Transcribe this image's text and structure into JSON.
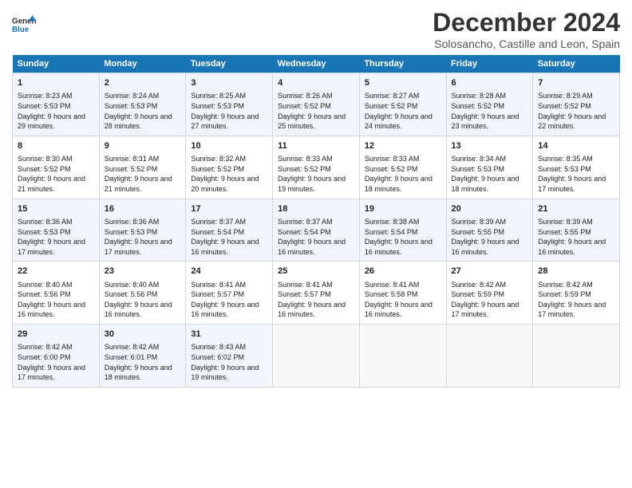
{
  "logo": {
    "line1": "General",
    "line2": "Blue"
  },
  "title": "December 2024",
  "subtitle": "Solosancho, Castille and Leon, Spain",
  "days_of_week": [
    "Sunday",
    "Monday",
    "Tuesday",
    "Wednesday",
    "Thursday",
    "Friday",
    "Saturday"
  ],
  "weeks": [
    [
      {
        "day": "1",
        "sunrise": "8:23 AM",
        "sunset": "5:53 PM",
        "daylight": "9 hours and 29 minutes."
      },
      {
        "day": "2",
        "sunrise": "8:24 AM",
        "sunset": "5:53 PM",
        "daylight": "9 hours and 28 minutes."
      },
      {
        "day": "3",
        "sunrise": "8:25 AM",
        "sunset": "5:53 PM",
        "daylight": "9 hours and 27 minutes."
      },
      {
        "day": "4",
        "sunrise": "8:26 AM",
        "sunset": "5:52 PM",
        "daylight": "9 hours and 25 minutes."
      },
      {
        "day": "5",
        "sunrise": "8:27 AM",
        "sunset": "5:52 PM",
        "daylight": "9 hours and 24 minutes."
      },
      {
        "day": "6",
        "sunrise": "8:28 AM",
        "sunset": "5:52 PM",
        "daylight": "9 hours and 23 minutes."
      },
      {
        "day": "7",
        "sunrise": "8:29 AM",
        "sunset": "5:52 PM",
        "daylight": "9 hours and 22 minutes."
      }
    ],
    [
      {
        "day": "8",
        "sunrise": "8:30 AM",
        "sunset": "5:52 PM",
        "daylight": "9 hours and 21 minutes."
      },
      {
        "day": "9",
        "sunrise": "8:31 AM",
        "sunset": "5:52 PM",
        "daylight": "9 hours and 21 minutes."
      },
      {
        "day": "10",
        "sunrise": "8:32 AM",
        "sunset": "5:52 PM",
        "daylight": "9 hours and 20 minutes."
      },
      {
        "day": "11",
        "sunrise": "8:33 AM",
        "sunset": "5:52 PM",
        "daylight": "9 hours and 19 minutes."
      },
      {
        "day": "12",
        "sunrise": "8:33 AM",
        "sunset": "5:52 PM",
        "daylight": "9 hours and 18 minutes."
      },
      {
        "day": "13",
        "sunrise": "8:34 AM",
        "sunset": "5:53 PM",
        "daylight": "9 hours and 18 minutes."
      },
      {
        "day": "14",
        "sunrise": "8:35 AM",
        "sunset": "5:53 PM",
        "daylight": "9 hours and 17 minutes."
      }
    ],
    [
      {
        "day": "15",
        "sunrise": "8:36 AM",
        "sunset": "5:53 PM",
        "daylight": "9 hours and 17 minutes."
      },
      {
        "day": "16",
        "sunrise": "8:36 AM",
        "sunset": "5:53 PM",
        "daylight": "9 hours and 17 minutes."
      },
      {
        "day": "17",
        "sunrise": "8:37 AM",
        "sunset": "5:54 PM",
        "daylight": "9 hours and 16 minutes."
      },
      {
        "day": "18",
        "sunrise": "8:37 AM",
        "sunset": "5:54 PM",
        "daylight": "9 hours and 16 minutes."
      },
      {
        "day": "19",
        "sunrise": "8:38 AM",
        "sunset": "5:54 PM",
        "daylight": "9 hours and 16 minutes."
      },
      {
        "day": "20",
        "sunrise": "8:39 AM",
        "sunset": "5:55 PM",
        "daylight": "9 hours and 16 minutes."
      },
      {
        "day": "21",
        "sunrise": "8:39 AM",
        "sunset": "5:55 PM",
        "daylight": "9 hours and 16 minutes."
      }
    ],
    [
      {
        "day": "22",
        "sunrise": "8:40 AM",
        "sunset": "5:56 PM",
        "daylight": "9 hours and 16 minutes."
      },
      {
        "day": "23",
        "sunrise": "8:40 AM",
        "sunset": "5:56 PM",
        "daylight": "9 hours and 16 minutes."
      },
      {
        "day": "24",
        "sunrise": "8:41 AM",
        "sunset": "5:57 PM",
        "daylight": "9 hours and 16 minutes."
      },
      {
        "day": "25",
        "sunrise": "8:41 AM",
        "sunset": "5:57 PM",
        "daylight": "9 hours and 16 minutes."
      },
      {
        "day": "26",
        "sunrise": "8:41 AM",
        "sunset": "5:58 PM",
        "daylight": "9 hours and 16 minutes."
      },
      {
        "day": "27",
        "sunrise": "8:42 AM",
        "sunset": "5:59 PM",
        "daylight": "9 hours and 17 minutes."
      },
      {
        "day": "28",
        "sunrise": "8:42 AM",
        "sunset": "5:59 PM",
        "daylight": "9 hours and 17 minutes."
      }
    ],
    [
      {
        "day": "29",
        "sunrise": "8:42 AM",
        "sunset": "6:00 PM",
        "daylight": "9 hours and 17 minutes."
      },
      {
        "day": "30",
        "sunrise": "8:42 AM",
        "sunset": "6:01 PM",
        "daylight": "9 hours and 18 minutes."
      },
      {
        "day": "31",
        "sunrise": "8:43 AM",
        "sunset": "6:02 PM",
        "daylight": "9 hours and 19 minutes."
      },
      null,
      null,
      null,
      null
    ]
  ],
  "labels": {
    "sunrise": "Sunrise:",
    "sunset": "Sunset:",
    "daylight": "Daylight:"
  }
}
